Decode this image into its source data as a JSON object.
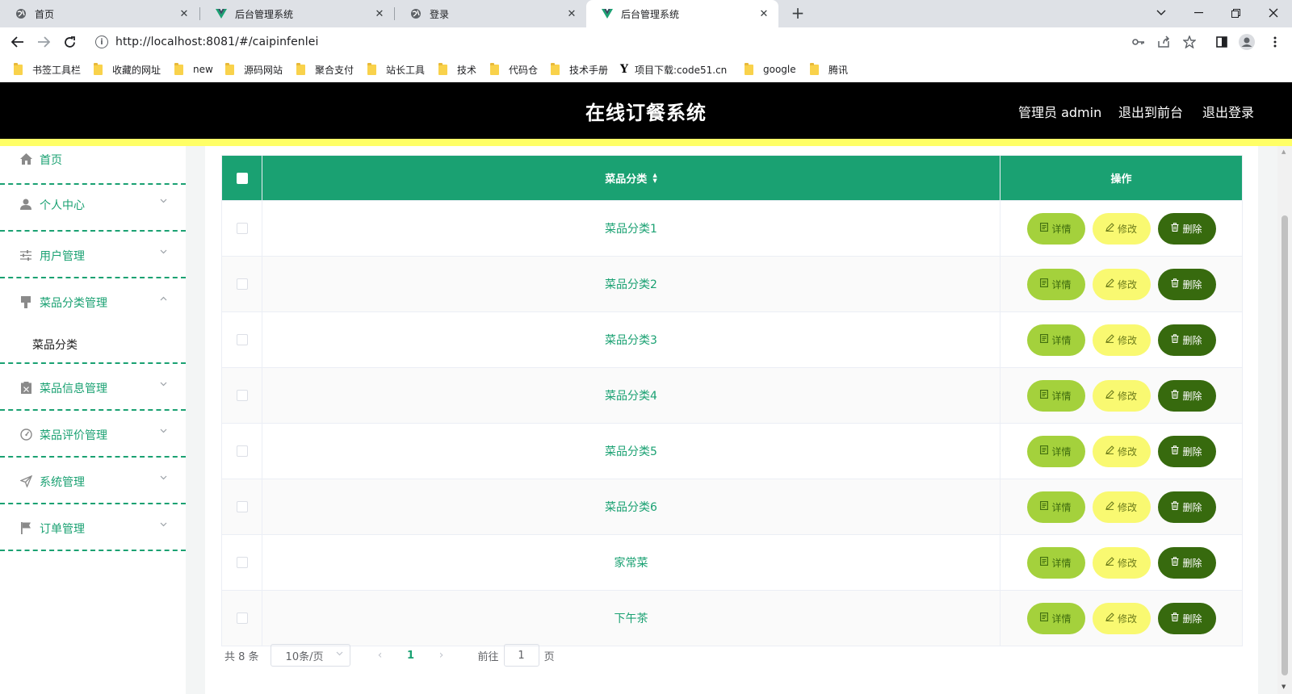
{
  "browser": {
    "tabs": [
      {
        "title": "首页",
        "icon": "globe-icon"
      },
      {
        "title": "后台管理系统",
        "icon": "vue-logo-icon"
      },
      {
        "title": "登录",
        "icon": "globe-icon"
      },
      {
        "title": "后台管理系统",
        "icon": "vue-logo-icon",
        "active": true
      }
    ],
    "url": "http://localhost:8081/#/caipinfenlei",
    "bookmarks": [
      "书签工具栏",
      "收藏的网址",
      "new",
      "源码网站",
      "聚合支付",
      "站长工具",
      "技术",
      "代码仓",
      "技术手册",
      "项目下载:code51.cn",
      "google",
      "腾讯"
    ]
  },
  "header": {
    "title": "在线订餐系统",
    "user_label": "管理员 admin",
    "back_front": "退出到前台",
    "logout": "退出登录"
  },
  "sidebar": {
    "items": [
      {
        "label": "首页",
        "icon": "home-icon"
      },
      {
        "label": "个人中心",
        "icon": "user-icon"
      },
      {
        "label": "用户管理",
        "icon": "sliders-icon"
      },
      {
        "label": "菜品分类管理",
        "icon": "brush-icon"
      },
      {
        "label": "菜品信息管理",
        "icon": "clipboard-icon"
      },
      {
        "label": "菜品评价管理",
        "icon": "gauge-icon"
      },
      {
        "label": "系统管理",
        "icon": "send-icon"
      },
      {
        "label": "订单管理",
        "icon": "flag-icon"
      }
    ],
    "submenu": {
      "label": "菜品分类"
    }
  },
  "table": {
    "columns": {
      "name": "菜品分类",
      "operation": "操作"
    },
    "rows": [
      "菜品分类1",
      "菜品分类2",
      "菜品分类3",
      "菜品分类4",
      "菜品分类5",
      "菜品分类6",
      "家常菜",
      "下午茶"
    ],
    "actions": {
      "detail": "详情",
      "edit": "修改",
      "delete": "删除"
    }
  },
  "pagination": {
    "total": "共 8 条",
    "page_size": "10条/页",
    "current_page": "1",
    "goto_prefix": "前往",
    "goto_value": "1",
    "goto_suffix": "页"
  },
  "colors": {
    "accent": "#1aa172",
    "header_bg": "#000000",
    "strip": "#ffff66",
    "detail_btn": "#a4d13c",
    "edit_btn": "#f9f971",
    "delete_btn": "#376a0e"
  }
}
